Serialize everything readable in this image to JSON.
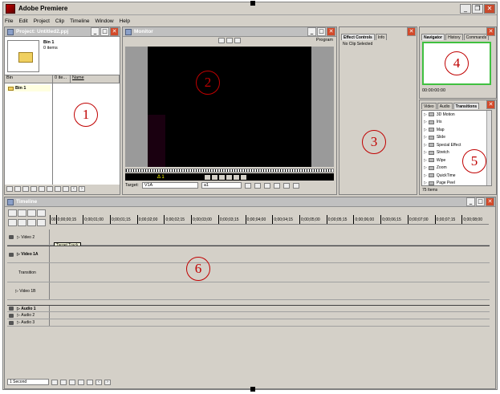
{
  "app": {
    "title": "Adobe Premiere",
    "menu": [
      "File",
      "Edit",
      "Project",
      "Clip",
      "Timeline",
      "Window",
      "Help"
    ]
  },
  "project": {
    "title": "Project: Untitled2.ppj",
    "bin_name": "Bin 1",
    "bin_count": "0 items",
    "col_bin": "Bin",
    "col_items": "0 ite...",
    "col_name": "Name",
    "bin_item": "Bin 1"
  },
  "monitor": {
    "title": "Monitor",
    "program_label": "Program",
    "timecode": "Δ 1",
    "target_label": "Target:",
    "target_value": "V1A",
    "audio_value": "a1"
  },
  "effects": {
    "tab_effect_controls": "Effect Controls",
    "tab_info": "Info",
    "no_clip": "No Clip Selected"
  },
  "navigator": {
    "tabs": [
      "Navigator",
      "History",
      "Commands"
    ],
    "timecode": "00:00:00:00"
  },
  "transitions": {
    "tabs": [
      "Video",
      "Audio",
      "Transitions"
    ],
    "items": [
      "3D Motion",
      "Iris",
      "Map",
      "Slide",
      "Special Effect",
      "Stretch",
      "Wipe",
      "Zoom",
      "QuickTime",
      "Page Peel"
    ],
    "count": "75 Items"
  },
  "timeline": {
    "title": "Timeline",
    "ruler": [
      "00",
      "0;00;00;15",
      "0;00;01;00",
      "0;00;01;15",
      "0;00;02;00",
      "0;00;02;15",
      "0;00;03;00",
      "0;00;03;15",
      "0;00;04;00",
      "0;00;04;15",
      "0;00;05;00",
      "0;00;05;15",
      "0;00;06;00",
      "0;00;06;15",
      "0;00;07;00",
      "0;00;07;15",
      "0;00;08;00"
    ],
    "tracks": {
      "video2": "Video 2",
      "video1a": "Video 1A",
      "transition": "Transition",
      "video1b": "Video 1B",
      "audio1": "Audio 1",
      "audio2": "Audio 2",
      "audio3": "Audio 3"
    },
    "tooltip": "Target Track",
    "zoom": "1 Second"
  },
  "annotations": [
    "1",
    "2",
    "3",
    "4",
    "5",
    "6"
  ]
}
